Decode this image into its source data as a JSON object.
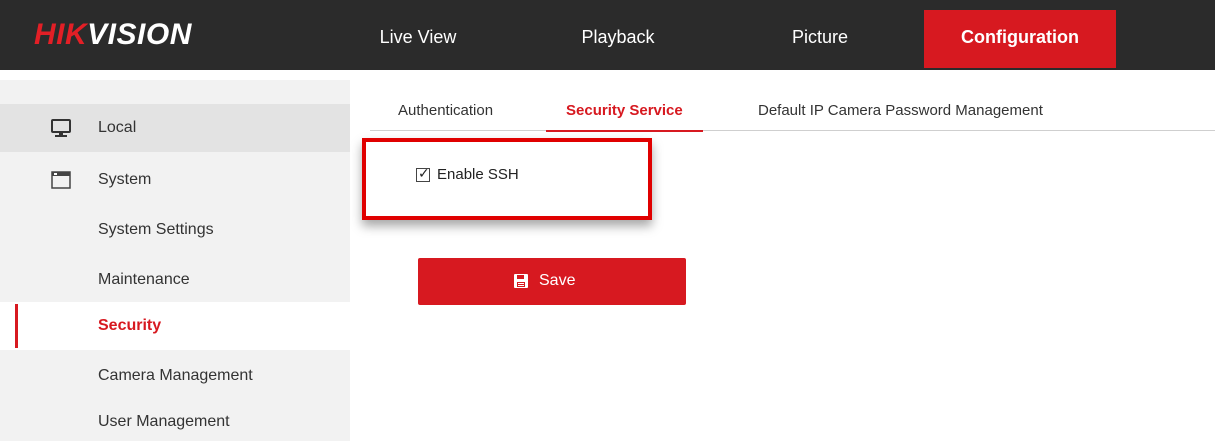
{
  "header": {
    "logo": {
      "hik": "HIK",
      "vision": "VISION"
    },
    "nav": [
      {
        "label": "Live View"
      },
      {
        "label": "Playback"
      },
      {
        "label": "Picture"
      },
      {
        "label": "Configuration",
        "active": true
      }
    ]
  },
  "sidebar": {
    "items": [
      {
        "label": "Local",
        "icon": "monitor-icon"
      },
      {
        "label": "System",
        "icon": "window-icon"
      },
      {
        "label": "System Settings"
      },
      {
        "label": "Maintenance"
      },
      {
        "label": "Security",
        "active": true
      },
      {
        "label": "Camera Management"
      },
      {
        "label": "User Management"
      }
    ]
  },
  "tabs": [
    {
      "label": "Authentication"
    },
    {
      "label": "Security Service",
      "active": true
    },
    {
      "label": "Default IP Camera Password Management"
    }
  ],
  "form": {
    "ssh_label": "Enable SSH",
    "ssh_checked": true,
    "check_mark": "✓",
    "save_label": "Save",
    "save_icon": "floppy-disk-icon"
  },
  "colors": {
    "accent": "#d71920",
    "topbar": "#2b2b2b",
    "sidebar": "#f2f2f2",
    "highlight": "#e00000"
  }
}
